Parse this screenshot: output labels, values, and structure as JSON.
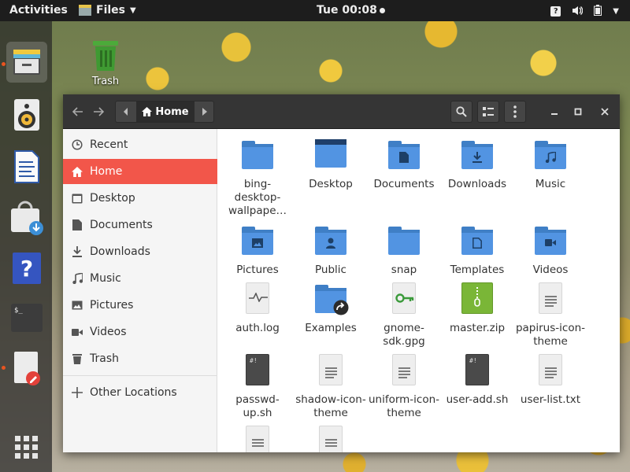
{
  "topbar": {
    "activities": "Activities",
    "app_menu": "Files",
    "clock": "Tue 00:08"
  },
  "desktop": {
    "trash_label": "Trash"
  },
  "window": {
    "path": {
      "current": "Home"
    },
    "sidebar": [
      {
        "label": "Recent",
        "icon": "clock-icon"
      },
      {
        "label": "Home",
        "icon": "home-icon",
        "selected": true
      },
      {
        "label": "Desktop",
        "icon": "desktop-icon"
      },
      {
        "label": "Documents",
        "icon": "document-icon"
      },
      {
        "label": "Downloads",
        "icon": "download-icon"
      },
      {
        "label": "Music",
        "icon": "music-icon"
      },
      {
        "label": "Pictures",
        "icon": "picture-icon"
      },
      {
        "label": "Videos",
        "icon": "video-icon"
      },
      {
        "label": "Trash",
        "icon": "trash-icon"
      },
      {
        "label": "Other Locations",
        "icon": "plus-icon"
      }
    ],
    "files": [
      {
        "name": "bing-desktop-wallpape…",
        "type": "folder",
        "emblem": ""
      },
      {
        "name": "Desktop",
        "type": "folder-desktop",
        "emblem": ""
      },
      {
        "name": "Documents",
        "type": "folder",
        "emblem": "document"
      },
      {
        "name": "Downloads",
        "type": "folder",
        "emblem": "download"
      },
      {
        "name": "Music",
        "type": "folder",
        "emblem": "music"
      },
      {
        "name": "Pictures",
        "type": "folder",
        "emblem": "picture"
      },
      {
        "name": "Public",
        "type": "folder",
        "emblem": "person"
      },
      {
        "name": "snap",
        "type": "folder",
        "emblem": ""
      },
      {
        "name": "Templates",
        "type": "folder",
        "emblem": "template"
      },
      {
        "name": "Videos",
        "type": "folder",
        "emblem": "video"
      },
      {
        "name": "auth.log",
        "type": "log"
      },
      {
        "name": "Examples",
        "type": "folder-link",
        "emblem": "link"
      },
      {
        "name": "gnome-sdk.gpg",
        "type": "key"
      },
      {
        "name": "master.zip",
        "type": "zip"
      },
      {
        "name": "papirus-icon-theme",
        "type": "text"
      },
      {
        "name": "passwd-up.sh",
        "type": "script"
      },
      {
        "name": "shadow-icon-theme",
        "type": "text"
      },
      {
        "name": "uniform-icon-theme",
        "type": "text"
      },
      {
        "name": "user-add.sh",
        "type": "script"
      },
      {
        "name": "user-list.txt",
        "type": "text"
      },
      {
        "name": "",
        "type": "text"
      },
      {
        "name": "",
        "type": "text"
      }
    ]
  }
}
